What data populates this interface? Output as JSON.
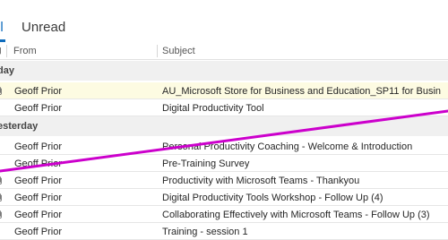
{
  "tabs": {
    "all": "ll",
    "unread": "Unread"
  },
  "columns": {
    "from": "From",
    "subject": "Subject"
  },
  "groups": {
    "today": "day",
    "yesterday": "esterday"
  },
  "today_rows": [
    {
      "from": "Geoff Prior",
      "subject": "AU_Microsoft Store for Business and Education_SP11 for Busin",
      "attachment": true,
      "highlight": true
    },
    {
      "from": "Geoff Prior",
      "subject": "Digital Productivity Tool",
      "attachment": false,
      "highlight": false
    }
  ],
  "yesterday_rows": [
    {
      "from": "Geoff Prior",
      "subject": "Personal Productivity Coaching - Welcome & Introduction",
      "attachment": false
    },
    {
      "from": "Geoff Prior",
      "subject": "Pre-Training Survey",
      "attachment": false
    },
    {
      "from": "Geoff Prior",
      "subject": "Productivity with Microsoft Teams - Thankyou",
      "attachment": true
    },
    {
      "from": "Geoff Prior",
      "subject": "Digital Productivity Tools Workshop - Follow Up (4)",
      "attachment": true
    },
    {
      "from": "Geoff Prior",
      "subject": "Collaborating Effectively with Microsoft Teams - Follow Up (3)",
      "attachment": true
    },
    {
      "from": "Geoff Prior",
      "subject": "Training - session 1",
      "attachment": false
    }
  ],
  "colors": {
    "accent": "#0f6cbd",
    "annotation": "#cc00cc",
    "highlight_row": "#fdfbe2",
    "group_bg": "#f0f0f0"
  },
  "icons": {
    "attachment": "paperclip-icon"
  }
}
